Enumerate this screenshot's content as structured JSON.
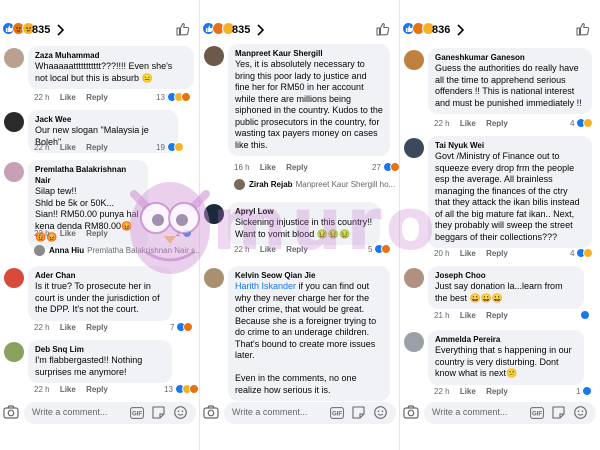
{
  "colors": {
    "like_blue": "#1877f2",
    "bubble_bg": "#f0f2f5",
    "meta_gray": "#65676b",
    "watermark": "#c678cc"
  },
  "columns": [
    {
      "reaction_count": "835",
      "comments": [
        {
          "name": "Zaza Muhammad",
          "text": "Whaaaaattttttttttt???!!!! Even she's not local but this is absurb 😑",
          "time": "22 h",
          "like": "Like",
          "reply": "Reply",
          "react_count": "13",
          "avatar_color": "#b9a090"
        },
        {
          "name": "Jack Wee",
          "text": "Our new slogan \"Malaysia je Boleh\"",
          "time": "22 h",
          "like": "Like",
          "reply": "Reply",
          "react_count": "19",
          "avatar_color": "#2a2a2a"
        },
        {
          "name": "Premlatha Balakrishnan Nair",
          "text": "Silap tew!!\nShld be 5k or 50K...\nSian!! RM50.00 punya hal kena denda RM80.00😡😡😡",
          "time": "22 h",
          "like": "Like",
          "reply": "Reply",
          "react_count": "2",
          "avatar_color": "#c7a0b6",
          "reply_preview": {
            "name": "Anna Hiu",
            "text": "Premlatha Balakrishnan Nair s...",
            "avatar_color": "#8a8a8a"
          }
        },
        {
          "name": "Ader Chan",
          "text": "Is it true? To prosecute her in court is under the jurisdiction of the DPP. It's not the court.",
          "time": "22 h",
          "like": "Like",
          "reply": "Reply",
          "react_count": "7",
          "avatar_color": "#d84a3a"
        },
        {
          "name": "Deb Snq Lim",
          "text": "I'm flabbergasted!! Nothing surprises me anymore!",
          "time": "22 h",
          "like": "Like",
          "reply": "Reply",
          "react_count": "13",
          "avatar_color": "#8ca060"
        }
      ],
      "composer_placeholder": "Write a comment..."
    },
    {
      "reaction_count": "835",
      "comments": [
        {
          "name": "Manpreet Kaur Shergill",
          "text": "Yes, it is absolutely necessary to bring this poor lady to justice and fine her for RM50 in her account while there are millions being siphoned in the country. Kudos to the public prosecutors in the country, for wasting tax payers money on cases like this.",
          "time": "16 h",
          "like": "Like",
          "reply": "Reply",
          "react_count": "27",
          "avatar_color": "#6b5a4a",
          "reply_preview": {
            "name": "Zirah Rejab",
            "text": "Manpreet Kaur Shergill ho...",
            "avatar_color": "#7a6a5a"
          }
        },
        {
          "name": "Apryl Low",
          "text": "Sickening injustice in this country!! Want to vomit blood 🤢🤢🤢",
          "time": "22 h",
          "like": "Like",
          "reply": "Reply",
          "react_count": "5",
          "avatar_color": "#1a2a3a"
        },
        {
          "name": "Kelvin Seow Qian Jie",
          "mention": "Harith Iskander",
          "text": " if you can find out why they never charge her for the other crime, that would be great. Because she is a foreigner trying to do crime to an underage children. That's bound to create more issues later.\n\nEven in the comments, no one realize how serious it is.",
          "time": "",
          "like": "",
          "reply": "",
          "react_count": "",
          "avatar_color": "#a89070"
        }
      ],
      "composer_placeholder": "Write a comment..."
    },
    {
      "reaction_count": "836",
      "comments": [
        {
          "name": "Ganeshkumar Ganeson",
          "text": "Guess the authorities do really have all the time to apprehend serious offenders !! This is national interest and must be punished immediately !!",
          "time": "22 h",
          "like": "Like",
          "reply": "Reply",
          "react_count": "4",
          "avatar_color": "#c08040"
        },
        {
          "name": "Tai Nyuk Wei",
          "text": "Govt /Ministry of Finance out to squeeze every drop frm the people esp the average. All brainless managing the finances of the ctry that they attack the ikan bilis instead of all the big mature fat ikan.. Next, they probably will sweep the street beggars of their collections???",
          "time": "20 h",
          "like": "Like",
          "reply": "Reply",
          "react_count": "4",
          "avatar_color": "#3a4a5a"
        },
        {
          "name": "Joseph Choo",
          "text": "Just say donation la...learn from the best 😀😀😀",
          "time": "21 h",
          "like": "Like",
          "reply": "Reply",
          "react_count": "",
          "avatar_color": "#b09080"
        },
        {
          "name": "Ammelda Pereira",
          "text": "Everything that s happening in our country is very disturbing. Dont know what is next😕",
          "time": "22 h",
          "like": "Like",
          "reply": "Reply",
          "react_count": "1",
          "avatar_color": "#9aa0a8"
        }
      ],
      "composer_placeholder": "Write a comment..."
    }
  ],
  "watermark": "muro",
  "icons": [
    "camera-icon",
    "emoji-icon",
    "gif-icon",
    "sticker-icon",
    "thumbs-up-icon",
    "chevron-right-icon"
  ]
}
